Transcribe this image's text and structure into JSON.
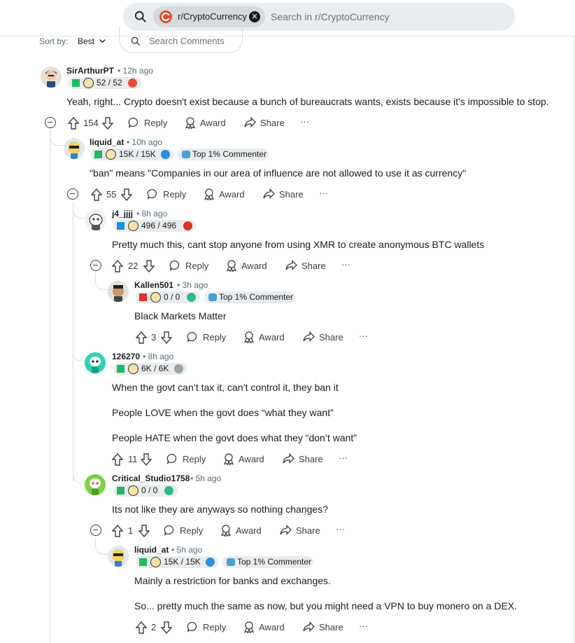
{
  "search": {
    "community": "r/CryptoCurrency",
    "placeholder": "Search in r/CryptoCurrency"
  },
  "sort": {
    "label": "Sort by:",
    "value": "Best",
    "comment_search_placeholder": "Search Comments"
  },
  "actions": {
    "reply": "Reply",
    "award": "Award",
    "share": "Share",
    "more": "···"
  },
  "comments": [
    {
      "username": "SirArthurPT",
      "time": "12h ago",
      "flair": "52 / 52",
      "flair_color": "#1db964",
      "emoji_color": "#e74c3c",
      "badge": "",
      "body": [
        "Yeah, right... Crypto doesn't exist because a bunch of bureaucrats wants, exists because it's impossible to stop."
      ],
      "score": "154"
    },
    {
      "username": "liquid_at",
      "time": "10h ago",
      "flair": "15K / 15K",
      "flair_color": "#1db964",
      "emoji_color": "#2b8fe0",
      "badge": "Top 1% Commenter",
      "body": [
        "\"ban\" means \"Companies in our area of influence are not allowed to use it as currency\""
      ],
      "score": "55"
    },
    {
      "username": "j4_jjjj",
      "time": "8h ago",
      "flair": "496 / 496",
      "flair_color": "#1a8fe0",
      "emoji_color": "#d9342b",
      "badge": "",
      "body": [
        "Pretty much this, cant stop anyone from using XMR to create anonymous BTC wallets"
      ],
      "score": "22"
    },
    {
      "username": "Kallen501",
      "time": "3h ago",
      "flair": "0 / 0",
      "flair_color": "#e0302b",
      "emoji_color": "#2fb98a",
      "badge": "Top 1% Commenter",
      "body": [
        "Black Markets Matter"
      ],
      "score": "3"
    },
    {
      "username": "126270",
      "time": "8h ago",
      "flair": "6K / 6K",
      "flair_color": "#1db964",
      "emoji_color": "#9aa3a8",
      "badge": "",
      "body": [
        "When the govt can’t tax it, can’t control it, they ban it",
        "People LOVE when the govt does “what they want”",
        "People HATE when the govt does what they “don’t want”"
      ],
      "score": "11"
    },
    {
      "username": "Critical_Studio1758",
      "time": "5h ago",
      "flair": "0 / 0",
      "flair_color": "#1db964",
      "emoji_color": "#2fb98a",
      "badge": "",
      "body": [
        "Its not like they are anyways so nothing changes?"
      ],
      "score": "1"
    },
    {
      "username": "liquid_at",
      "time": "5h ago",
      "flair": "15K / 15K",
      "flair_color": "#1db964",
      "emoji_color": "#2b8fe0",
      "badge": "Top 1% Commenter",
      "body": [
        "Mainly a restriction for banks and exchanges.",
        "So... pretty much the same as now, but you might need a VPN to buy monero on a DEX."
      ],
      "score": "2"
    }
  ]
}
